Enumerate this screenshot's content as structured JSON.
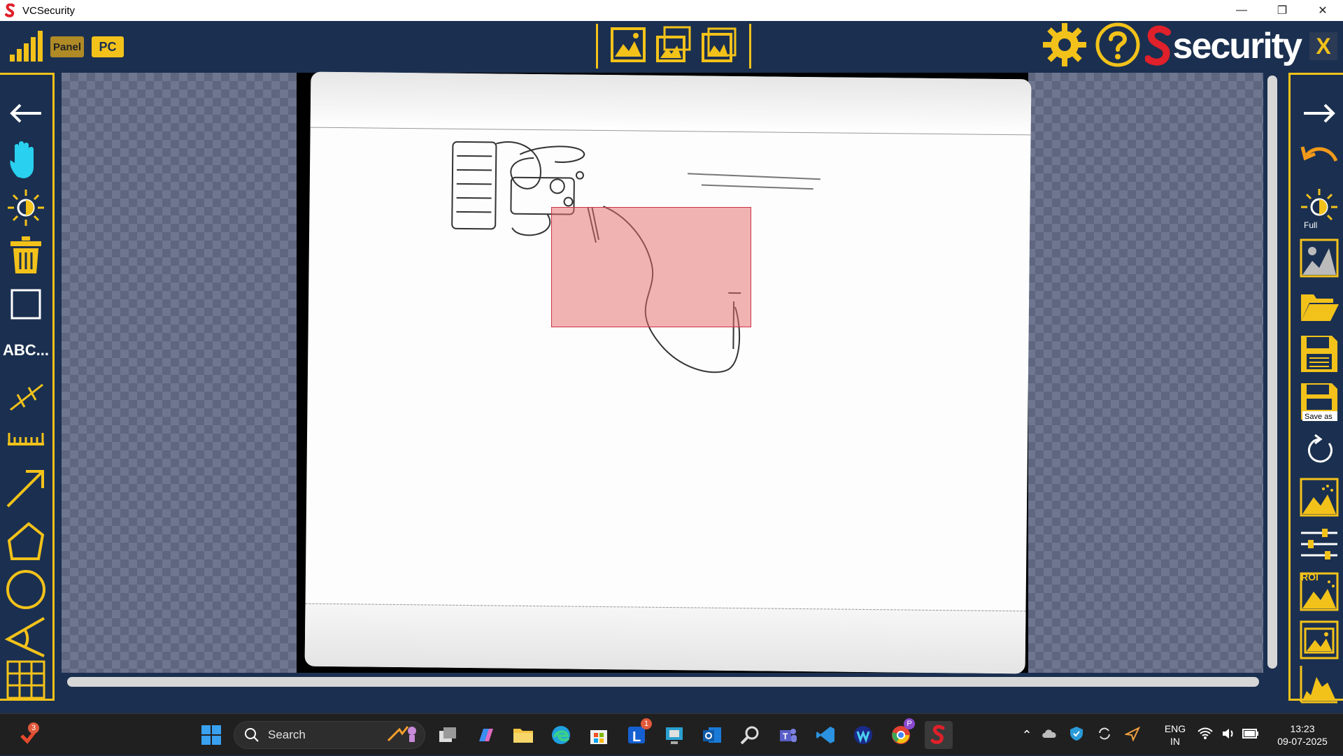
{
  "window": {
    "title": "VCSecurity",
    "minimize_glyph": "—",
    "restore_glyph": "❐",
    "close_glyph": "✕"
  },
  "toolbar": {
    "panel_label": "Panel",
    "pc_label": "PC",
    "brand_text": "security",
    "close_label": "X"
  },
  "left_tools": [
    {
      "name": "back-arrow-icon"
    },
    {
      "name": "hand-pan-icon"
    },
    {
      "name": "brightness-icon"
    },
    {
      "name": "trash-icon"
    },
    {
      "name": "rectangle-tool-icon"
    },
    {
      "name": "text-tool-icon",
      "label": "ABC..."
    },
    {
      "name": "line-tool-icon"
    },
    {
      "name": "ruler-tool-icon"
    },
    {
      "name": "arrow-tool-icon"
    },
    {
      "name": "polygon-tool-icon"
    },
    {
      "name": "circle-tool-icon"
    },
    {
      "name": "angle-tool-icon"
    },
    {
      "name": "grid-tool-icon"
    }
  ],
  "right_tools": [
    {
      "name": "forward-arrow-icon"
    },
    {
      "name": "undo-icon"
    },
    {
      "name": "brightness-full-icon",
      "label": "Full"
    },
    {
      "name": "image-histogram-icon"
    },
    {
      "name": "open-folder-icon"
    },
    {
      "name": "save-icon"
    },
    {
      "name": "save-as-icon",
      "label": "Save as"
    },
    {
      "name": "reset-icon"
    },
    {
      "name": "enhance-image-icon"
    },
    {
      "name": "adjust-sliders-icon"
    },
    {
      "name": "roi-enhance-icon",
      "label": "ROI"
    },
    {
      "name": "image-frame-icon"
    },
    {
      "name": "histogram-icon"
    }
  ],
  "taskbar": {
    "search_placeholder": "Search",
    "notification_count": "3",
    "lens_badge": "1",
    "chrome_badge": "P",
    "lang_line1": "ENG",
    "lang_line2": "IN",
    "time": "13:23",
    "date": "09-07-2025"
  },
  "colors": {
    "accent": "#f3c21a",
    "background": "#1b3050",
    "roi_fill": "#e66e6e",
    "brand_red": "#e0202a"
  }
}
